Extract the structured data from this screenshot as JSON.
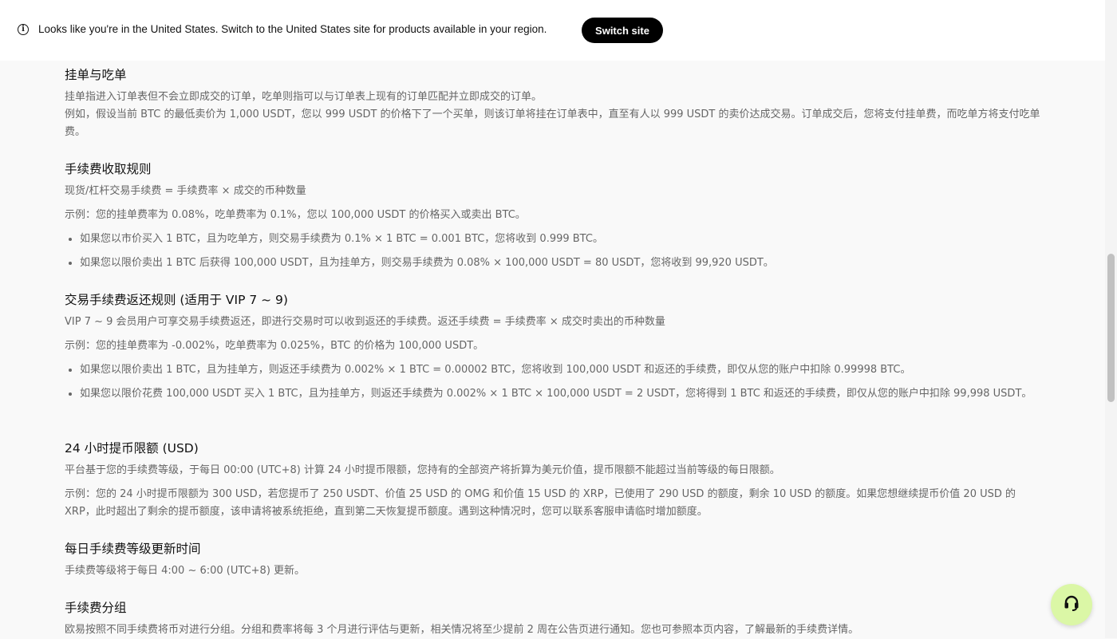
{
  "banner": {
    "icon": "info-icon",
    "message": "Looks like you're in the United States. Switch to the United States site for products available in your region.",
    "button_label": "Switch site"
  },
  "sections": {
    "maker_taker": {
      "title": "挂单与吃单",
      "p1": "挂单指进入订单表但不会立即成交的订单，吃单则指可以与订单表上现有的订单匹配并立即成交的订单。",
      "p2": "例如，假设当前 BTC 的最低卖价为 1,000 USDT，您以 999 USDT 的价格下了一个买单，则该订单将挂在订单表中，直至有人以 999 USDT 的卖价达成交易。订单成交后，您将支付挂单费，而吃单方将支付吃单费。"
    },
    "fee_rules": {
      "title": "手续费收取规则",
      "formula": "现货/杠杆交易手续费 = 手续费率 × 成交的币种数量",
      "example": "示例：您的挂单费率为 0.08%，吃单费率为 0.1%，您以 100,000 USDT 的价格买入或卖出 BTC。",
      "bullets": [
        "如果您以市价买入 1 BTC，且为吃单方，则交易手续费为 0.1% × 1 BTC = 0.001 BTC，您将收到 0.999 BTC。",
        "如果您以限价卖出 1 BTC 后获得 100,000 USDT，且为挂单方，则交易手续费为 0.08% × 100,000 USDT = 80 USDT，您将收到 99,920 USDT。"
      ]
    },
    "rebate_rules": {
      "title": "交易手续费返还规则 (适用于 VIP 7 ~ 9)",
      "desc": "VIP 7 ~ 9 会员用户可享交易手续费返还，即进行交易时可以收到返还的手续费。返还手续费 = 手续费率 × 成交时卖出的币种数量",
      "example": "示例：您的挂单费率为 -0.002%，吃单费率为 0.025%，BTC 的价格为 100,000 USDT。",
      "bullets": [
        "如果您以限价卖出 1 BTC，且为挂单方，则返还手续费为 0.002% × 1 BTC = 0.00002 BTC，您将收到 100,000 USDT 和返还的手续费，即仅从您的账户中扣除 0.99998 BTC。",
        "如果您以限价花费 100,000 USDT 买入 1 BTC，且为挂单方，则返还手续费为 0.002% × 1 BTC × 100,000 USDT = 2 USDT，您将得到 1 BTC 和返还的手续费，即仅从您的账户中扣除 99,998 USDT。"
      ]
    },
    "withdraw_limit": {
      "title": "24 小时提币限额 (USD)",
      "desc": "平台基于您的手续费等级，于每日 00:00 (UTC+8) 计算 24 小时提币限额，您持有的全部资产将折算为美元价值，提币限额不能超过当前等级的每日限额。",
      "example": "示例：您的 24 小时提币限额为 300 USD，若您提币了 250 USDT、价值 25 USD 的 OMG 和价值 15 USD 的 XRP，已使用了 290 USD 的额度，剩余 10 USD 的额度。如果您想继续提币价值 20 USD 的 XRP，此时超出了剩余的提币额度，该申请将被系统拒绝，直到第二天恢复提币额度。遇到这种情况时，您可以联系客服申请临时增加额度。"
    },
    "update_time": {
      "title": "每日手续费等级更新时间",
      "desc": "手续费等级将于每日 4:00 ~ 6:00 (UTC+8) 更新。"
    },
    "fee_groups": {
      "title": "手续费分组",
      "desc": "欧易按照不同手续费将币对进行分组。分组和费率将每 3 个月进行评估与更新，相关情况将至少提前 2 周在公告页进行通知。您也可参照本页内容，了解最新的手续费详情。"
    }
  },
  "support": {
    "icon": "headset-icon",
    "color": "#dbf7a6"
  }
}
